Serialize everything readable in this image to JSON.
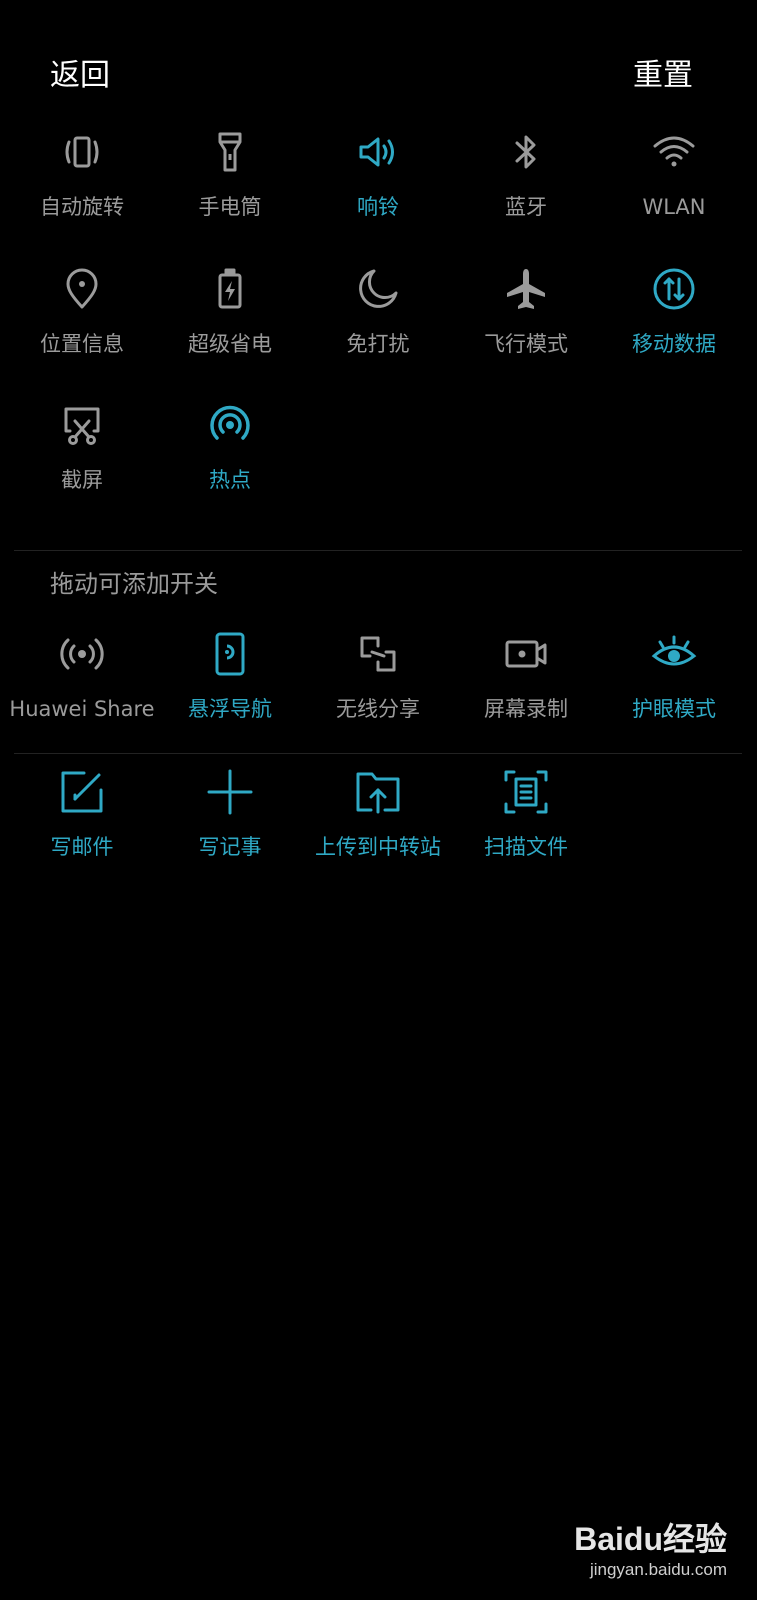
{
  "header": {
    "back_label": "返回",
    "reset_label": "重置"
  },
  "active_tiles": [
    {
      "label": "自动旋转",
      "icon": "rotate-icon",
      "state": "off"
    },
    {
      "label": "手电筒",
      "icon": "flashlight-icon",
      "state": "off"
    },
    {
      "label": "响铃",
      "icon": "speaker-icon",
      "state": "on"
    },
    {
      "label": "蓝牙",
      "icon": "bluetooth-icon",
      "state": "off"
    },
    {
      "label": "WLAN",
      "icon": "wifi-icon",
      "state": "off"
    },
    {
      "label": "位置信息",
      "icon": "location-icon",
      "state": "off"
    },
    {
      "label": "超级省电",
      "icon": "battery-icon",
      "state": "off"
    },
    {
      "label": "免打扰",
      "icon": "moon-icon",
      "state": "off"
    },
    {
      "label": "飞行模式",
      "icon": "airplane-icon",
      "state": "off"
    },
    {
      "label": "移动数据",
      "icon": "mobile-data-icon",
      "state": "on"
    },
    {
      "label": "截屏",
      "icon": "screenshot-icon",
      "state": "off"
    },
    {
      "label": "热点",
      "icon": "hotspot-icon",
      "state": "on"
    }
  ],
  "available": {
    "title": "拖动可添加开关",
    "tiles": [
      {
        "label": "Huawei Share",
        "icon": "huawei-share-icon",
        "state": "off"
      },
      {
        "label": "悬浮导航",
        "icon": "floating-nav-icon",
        "state": "on"
      },
      {
        "label": "无线分享",
        "icon": "wireless-share-icon",
        "state": "off"
      },
      {
        "label": "屏幕录制",
        "icon": "screen-record-icon",
        "state": "off"
      },
      {
        "label": "护眼模式",
        "icon": "eye-icon",
        "state": "on"
      }
    ]
  },
  "shortcuts": [
    {
      "label": "写邮件",
      "icon": "compose-icon"
    },
    {
      "label": "写记事",
      "icon": "plus-icon"
    },
    {
      "label": "上传到中转站",
      "icon": "folder-upload-icon"
    },
    {
      "label": "扫描文件",
      "icon": "scan-document-icon"
    }
  ],
  "watermark": {
    "logo": "Baidu经验",
    "url": "jingyan.baidu.com"
  },
  "colors": {
    "accent": "#2fa9c5",
    "inactive": "#9b9b9b",
    "background": "#000000"
  }
}
